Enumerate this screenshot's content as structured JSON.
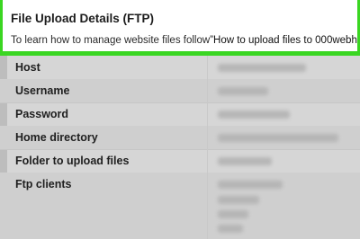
{
  "header": {
    "title": "File Upload Details (FTP)",
    "subtitle_prefix": "To learn how to manage website files follow",
    "subtitle_link": "”How to upload files to 000webh"
  },
  "rows": [
    {
      "label": "Host"
    },
    {
      "label": "Username"
    },
    {
      "label": "Password"
    },
    {
      "label": "Home directory"
    },
    {
      "label": "Folder to upload files"
    },
    {
      "label": "Ftp clients"
    }
  ],
  "colors": {
    "accent": "#3ad622",
    "table_bg": "#d6d6d6",
    "header_bg": "#ffffff"
  }
}
